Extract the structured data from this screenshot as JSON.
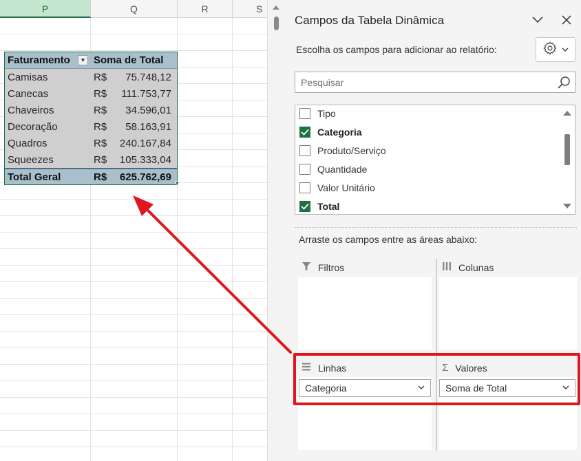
{
  "sheet": {
    "columns": [
      "P",
      "Q",
      "R",
      "S"
    ],
    "pivot_header": {
      "row_label": "Faturamento",
      "value_label": "Soma de Total"
    },
    "rows": [
      {
        "label": "Camisas",
        "currency": "R$",
        "value": "75.748,12"
      },
      {
        "label": "Canecas",
        "currency": "R$",
        "value": "111.753,77"
      },
      {
        "label": "Chaveiros",
        "currency": "R$",
        "value": "34.596,01"
      },
      {
        "label": "Decoração",
        "currency": "R$",
        "value": "58.163,91"
      },
      {
        "label": "Quadros",
        "currency": "R$",
        "value": "240.167,84"
      },
      {
        "label": "Squeezes",
        "currency": "R$",
        "value": "105.333,04"
      }
    ],
    "total": {
      "label": "Total Geral",
      "currency": "R$",
      "value": "625.762,69"
    }
  },
  "panel": {
    "title": "Campos da Tabela Dinâmica",
    "subtitle": "Escolha os campos para adicionar ao relatório:",
    "search_placeholder": "Pesquisar",
    "fields": [
      {
        "label": "Tipo",
        "checked": false
      },
      {
        "label": "Categoria",
        "checked": true
      },
      {
        "label": "Produto/Serviço",
        "checked": false
      },
      {
        "label": "Quantidade",
        "checked": false
      },
      {
        "label": "Valor Unitário",
        "checked": false
      },
      {
        "label": "Total",
        "checked": true
      }
    ],
    "drag_label": "Arraste os campos entre as áreas abaixo:",
    "areas": {
      "filters": "Filtros",
      "columns": "Colunas",
      "rows": "Linhas",
      "values": "Valores"
    },
    "rows_field": "Categoria",
    "values_field": "Soma de Total"
  },
  "colors": {
    "accent": "#1e7145",
    "highlight": "#e0161e",
    "pivot_header": "#a9bfcc"
  }
}
